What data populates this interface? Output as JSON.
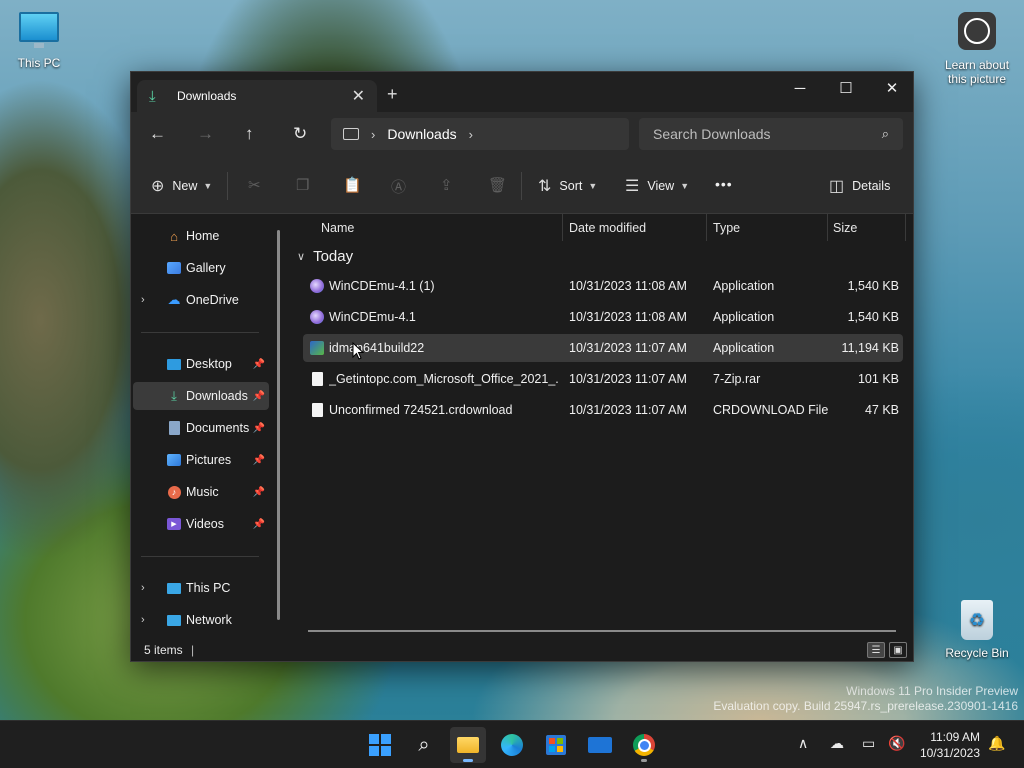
{
  "desktop": {
    "icons": {
      "this_pc": "This PC",
      "learn": "Learn about this picture",
      "recycle": "Recycle Bin"
    },
    "watermark": {
      "line1": "Windows 11 Pro Insider Preview",
      "line2": "Evaluation copy. Build 25947.rs_prerelease.230901-1416"
    }
  },
  "window": {
    "tab": {
      "title": "Downloads",
      "icon": "download-icon"
    },
    "controls": {
      "minimize": "─",
      "maximize": "☐",
      "close": "✕"
    },
    "address": {
      "breadcrumb": "Downloads"
    },
    "search": {
      "placeholder": "Search Downloads"
    },
    "commands": {
      "new": "New",
      "sort": "Sort",
      "view": "View",
      "more": "•••",
      "details": "Details"
    },
    "nav": {
      "home": "Home",
      "gallery": "Gallery",
      "onedrive": "OneDrive",
      "quick": [
        {
          "label": "Desktop",
          "icon": "desktop-icon"
        },
        {
          "label": "Downloads",
          "icon": "download-icon"
        },
        {
          "label": "Documents",
          "icon": "documents-icon"
        },
        {
          "label": "Pictures",
          "icon": "pictures-icon"
        },
        {
          "label": "Music",
          "icon": "music-icon"
        },
        {
          "label": "Videos",
          "icon": "videos-icon"
        }
      ],
      "this_pc": "This PC",
      "network": "Network"
    },
    "columns": {
      "name": "Name",
      "date": "Date modified",
      "type": "Type",
      "size": "Size"
    },
    "group": "Today",
    "files": [
      {
        "name": "WinCDEmu-4.1 (1)",
        "date": "10/31/2023 11:08 AM",
        "type": "Application",
        "size": "1,540 KB"
      },
      {
        "name": "WinCDEmu-4.1",
        "date": "10/31/2023 11:08 AM",
        "type": "Application",
        "size": "1,540 KB"
      },
      {
        "name": "idman641build22",
        "date": "10/31/2023 11:07 AM",
        "type": "Application",
        "size": "11,194 KB"
      },
      {
        "name": "_Getintopc.com_Microsoft_Office_2021_...",
        "date": "10/31/2023 11:07 AM",
        "type": "7-Zip.rar",
        "size": "101 KB"
      },
      {
        "name": "Unconfirmed 724521.crdownload",
        "date": "10/31/2023 11:07 AM",
        "type": "CRDOWNLOAD File",
        "size": "47 KB"
      }
    ],
    "status": {
      "count": "5 items"
    }
  },
  "taskbar": {
    "clock": {
      "time": "11:09 AM",
      "date": "10/31/2023"
    }
  }
}
